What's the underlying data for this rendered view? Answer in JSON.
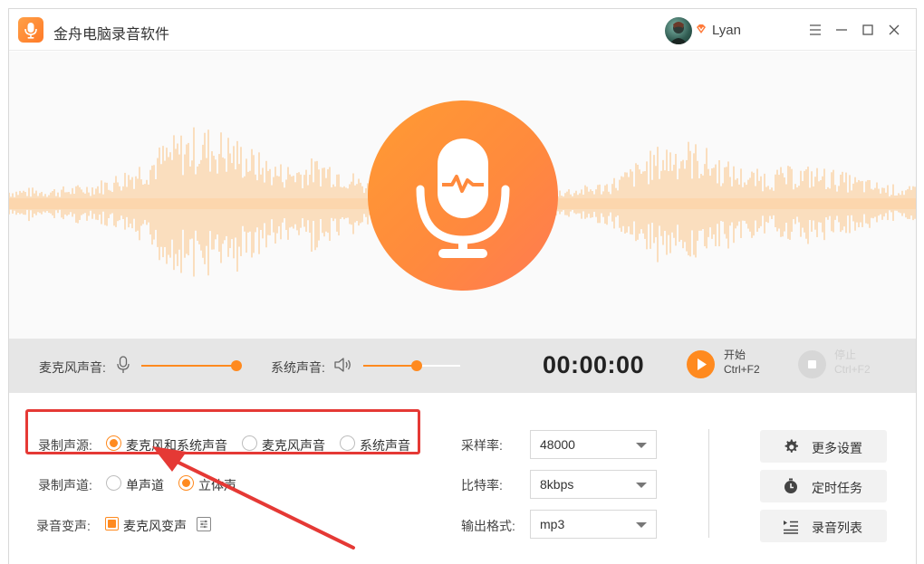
{
  "app": {
    "title": "金舟电脑录音软件",
    "username": "Lyan",
    "accent_color": "#ff8a1f"
  },
  "window_controls": {
    "icons": [
      "menu-icon",
      "minimize-icon",
      "maximize-icon",
      "close-icon"
    ]
  },
  "controls": {
    "mic_volume_label": "麦克风声音:",
    "mic_volume_level": 0.95,
    "system_volume_label": "系统声音:",
    "system_volume_level": 0.55,
    "timer": "00:00:00",
    "start_label": "开始",
    "start_shortcut": "Ctrl+F2",
    "stop_label": "停止",
    "stop_shortcut": "Ctrl+F2"
  },
  "settings": {
    "source": {
      "label": "录制声源:",
      "options": [
        "麦克风和系统声音",
        "麦克风声音",
        "系统声音"
      ],
      "selected": "麦克风和系统声音"
    },
    "channel": {
      "label": "录制声道:",
      "options": [
        "单声道",
        "立体声"
      ],
      "selected": "立体声"
    },
    "voice_change": {
      "label": "录音变声:",
      "option": "麦克风变声",
      "checked": true
    },
    "sample_rate": {
      "label": "采样率:",
      "value": "48000"
    },
    "bit_rate": {
      "label": "比特率:",
      "value": "8kbps"
    },
    "output_format": {
      "label": "输出格式:",
      "value": "mp3"
    }
  },
  "side_buttons": {
    "more_settings": "更多设置",
    "scheduled_task": "定时任务",
    "recording_list": "录音列表"
  }
}
